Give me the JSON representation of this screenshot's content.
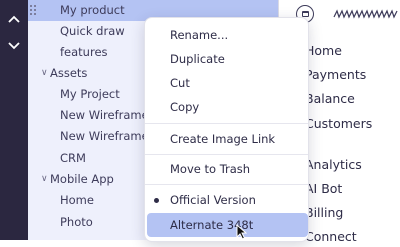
{
  "tree": {
    "items": [
      {
        "label": "My product",
        "selected": true
      },
      {
        "label": "Quick draw"
      },
      {
        "label": "features"
      },
      {
        "label": "Assets",
        "folder": true
      },
      {
        "label": "My Project"
      },
      {
        "label": "New Wireframe 3"
      },
      {
        "label": "New Wireframe 4"
      },
      {
        "label": "CRM"
      },
      {
        "label": "Mobile App",
        "folder": true
      },
      {
        "label": "Home"
      },
      {
        "label": "Photo"
      }
    ]
  },
  "context_menu": {
    "items": [
      {
        "label": "Rename..."
      },
      {
        "label": "Duplicate"
      },
      {
        "label": "Cut"
      },
      {
        "label": "Copy"
      },
      {
        "label": "Create Image Link"
      },
      {
        "label": "Move to Trash"
      },
      {
        "label": "Official Version"
      },
      {
        "label": "Alternate 348t"
      }
    ]
  },
  "nav": {
    "items": [
      {
        "label": "Home"
      },
      {
        "label": "Payments"
      },
      {
        "label": "Balance"
      },
      {
        "label": "Customers"
      },
      {
        "label": "Analytics"
      },
      {
        "label": "AI Bot"
      },
      {
        "label": "Billing"
      },
      {
        "label": "Connect"
      }
    ]
  },
  "colors": {
    "rail": "#2b2740",
    "tree_bg": "#eef0fc",
    "selection": "#b4c3f3",
    "text": "#2e2c47"
  }
}
